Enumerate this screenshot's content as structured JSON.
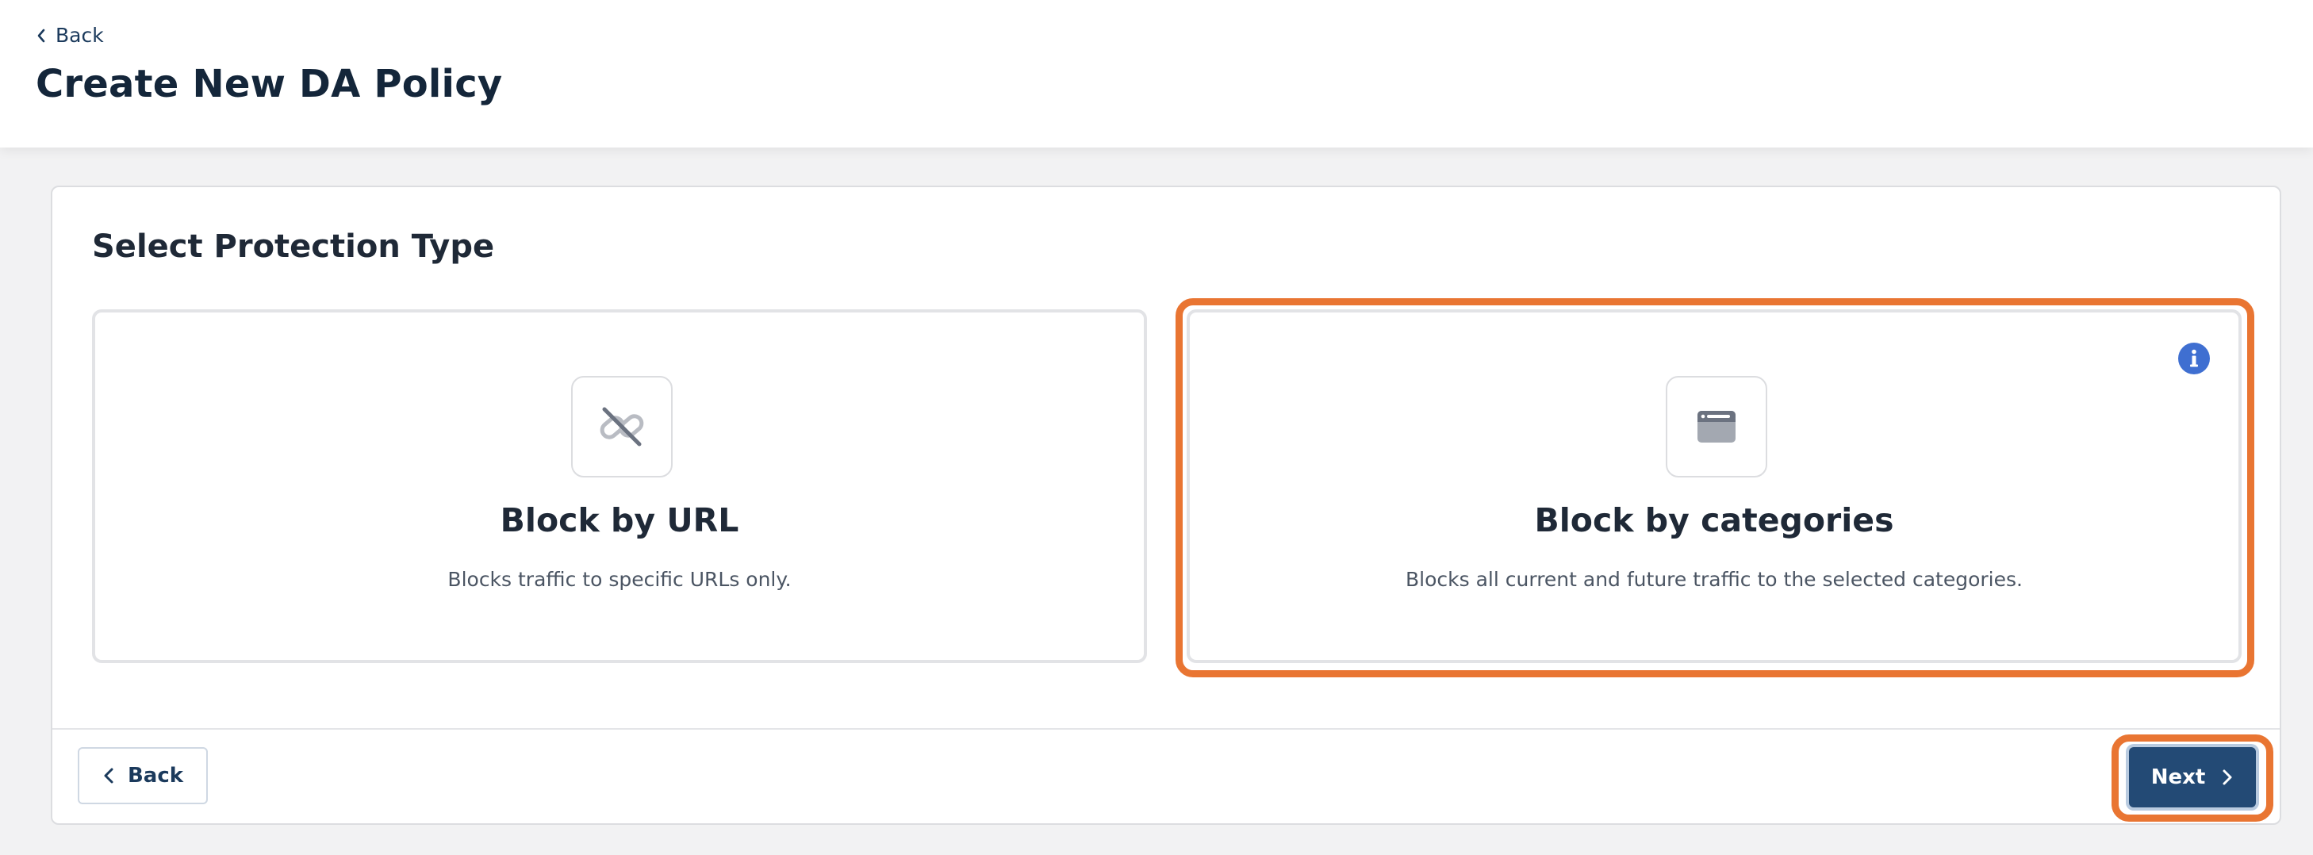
{
  "header": {
    "back_label": "Back",
    "title": "Create New DA Policy"
  },
  "panel": {
    "section_title": "Select Protection Type",
    "options": [
      {
        "title": "Block by URL",
        "description": "Blocks traffic to specific URLs only.",
        "icon": "link-off-icon",
        "selected": false
      },
      {
        "title": "Block by categories",
        "description": "Blocks all current and future traffic to the selected categories.",
        "icon": "browser-window-icon",
        "selected": true
      }
    ],
    "info_icon": "info-icon"
  },
  "footer": {
    "back_label": "Back",
    "next_label": "Next"
  },
  "colors": {
    "primary": "#234a75",
    "highlight": "#e97532",
    "info": "#3f6fd1",
    "link": "#1b3a5c"
  }
}
